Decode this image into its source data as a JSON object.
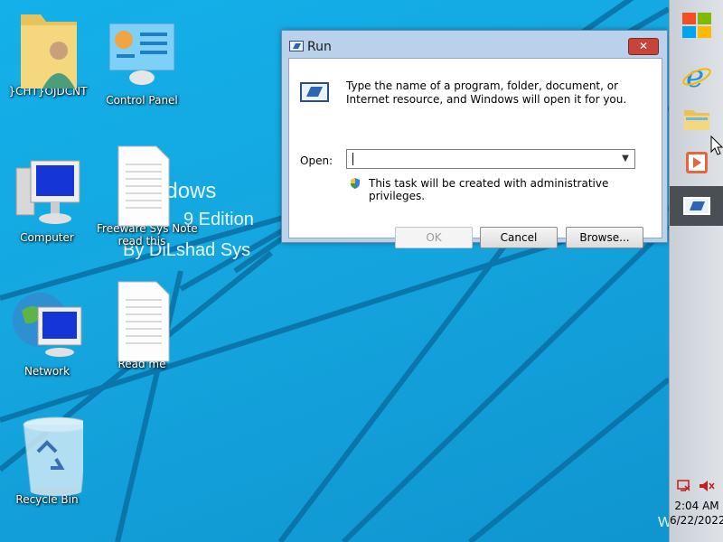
{
  "desktop": {
    "wallpaper_text": [
      "ndows",
      "9 Edition",
      "By DiLshad Sys",
      "W"
    ],
    "icons": [
      {
        "label": "}CHT}OJDCNT",
        "icon": "user-folder-icon"
      },
      {
        "label": "Control Panel",
        "icon": "control-panel-icon"
      },
      {
        "label": "Computer",
        "icon": "computer-icon"
      },
      {
        "label": "Freeware Sys Note",
        "sublabel": "read this",
        "icon": "document-icon"
      },
      {
        "label": "Network",
        "icon": "network-icon"
      },
      {
        "label": "Read me",
        "icon": "document-icon"
      },
      {
        "label": "Recycle Bin",
        "icon": "recycle-bin-icon"
      }
    ]
  },
  "run_dialog": {
    "title": "Run",
    "close_label": "✕",
    "description": "Type the name of a program, folder, document, or Internet resource, and Windows will open it for you.",
    "open_label": "Open:",
    "open_value": "",
    "admin_note": "This task will be created with administrative privileges.",
    "buttons": {
      "ok": "OK",
      "cancel": "Cancel",
      "browse": "Browse..."
    }
  },
  "taskbar": {
    "items": [
      "start-icon",
      "internet-explorer-icon",
      "file-explorer-icon",
      "media-player-icon",
      "run-app-icon"
    ],
    "clock": {
      "time": "2:04 AM",
      "date": "6/22/2022"
    }
  },
  "colors": {
    "desktop": "#15a6df",
    "taskbar": "#d6dbe1",
    "dialog_frame": "#b9d1ea",
    "close": "#c7443a"
  }
}
